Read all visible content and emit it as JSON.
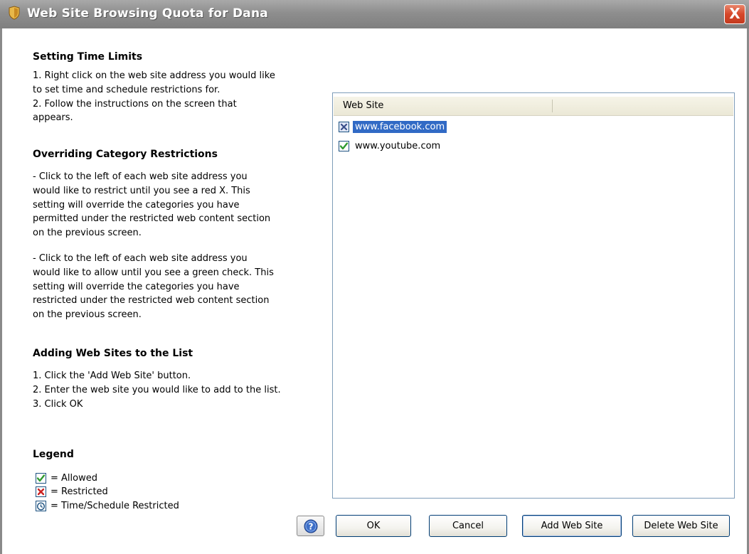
{
  "window": {
    "title": "Web Site Browsing Quota for Dana",
    "close_label": "X"
  },
  "instructions": {
    "time_limits": {
      "heading": "Setting Time Limits",
      "text": "1. Right click on the web site address you would like\nto set time and schedule restrictions for.\n2. Follow the instructions on the screen that\nappears."
    },
    "override": {
      "heading": "Overriding Category Restrictions",
      "text1": "- Click to the left of each web site address you\nwould like to restrict until you see a red X. This\nsetting will override the categories you have\npermitted under the restricted web content section\non the previous screen.",
      "text2": "- Click to the left of each web site address you\nwould like to allow until you see a green check. This\nsetting will override the categories you have\nrestricted under the restricted web content section\non the previous screen."
    },
    "adding": {
      "heading": "Adding Web Sites to the List",
      "text": "1. Click the 'Add Web Site' button.\n2. Enter the web site you would like to add to the list.\n3. Click OK"
    }
  },
  "legend": {
    "heading": "Legend",
    "items": [
      {
        "label": "= Allowed",
        "icon": "green-check-icon"
      },
      {
        "label": "= Restricted",
        "icon": "red-x-icon"
      },
      {
        "label": "= Time/Schedule Restricted",
        "icon": "clock-icon"
      }
    ]
  },
  "website_list": {
    "column_header": "Web Site",
    "rows": [
      {
        "site": "www.facebook.com",
        "state": "restricted",
        "selected": true
      },
      {
        "site": "www.youtube.com",
        "state": "allowed",
        "selected": false
      }
    ]
  },
  "buttons": {
    "help": "help-icon",
    "ok": "OK",
    "cancel": "Cancel",
    "add": "Add Web Site",
    "delete": "Delete Web Site"
  },
  "colors": {
    "selection": "#316ac5",
    "allowed": "#2f9a2f",
    "restricted": "#cc2222",
    "title_bar": "#8e8e8e",
    "close": "#d6472a"
  }
}
